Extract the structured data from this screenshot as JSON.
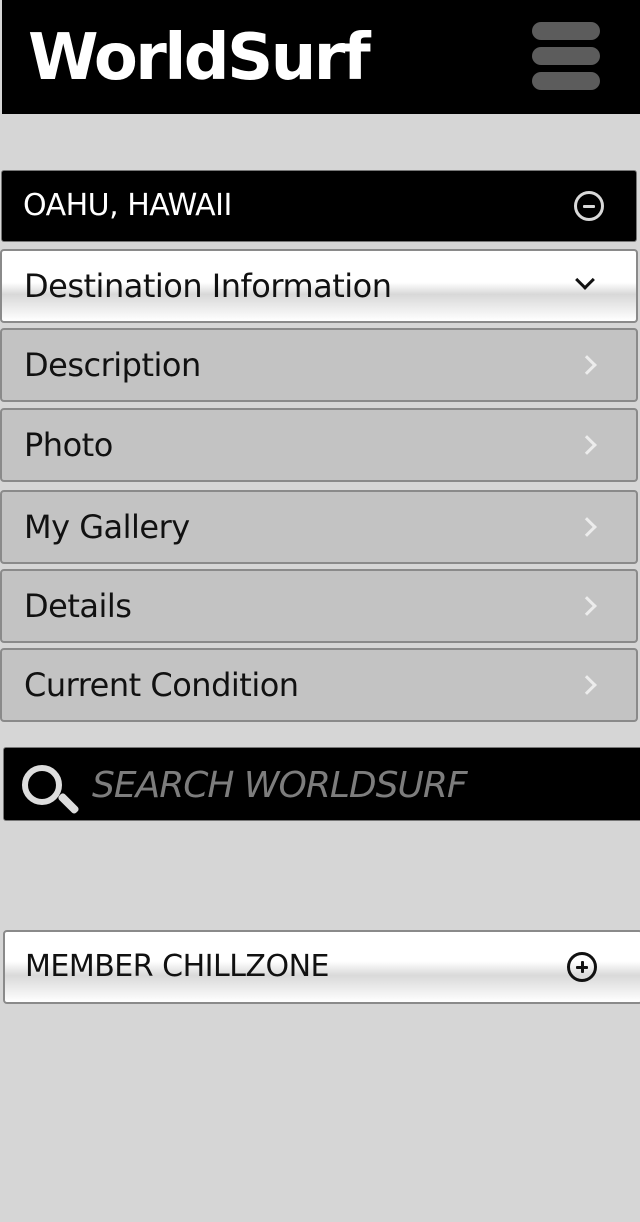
{
  "app": {
    "title": "WorldSurf"
  },
  "header": {
    "menu_icon": "hamburger-menu-icon"
  },
  "location_section": {
    "title": "OAHU, HAWAII",
    "toggle_icon": "minus-circle-icon",
    "items": [
      {
        "label": "Destination Information",
        "state": "expanded",
        "icon": "chevron-down-icon"
      },
      {
        "label": "Description",
        "state": "collapsed",
        "icon": "chevron-right-icon"
      },
      {
        "label": "Photo",
        "state": "collapsed",
        "icon": "chevron-right-icon"
      },
      {
        "label": "My Gallery",
        "state": "collapsed",
        "icon": "chevron-right-icon"
      },
      {
        "label": "Details",
        "state": "collapsed",
        "icon": "chevron-right-icon"
      },
      {
        "label": "Current Condition",
        "state": "collapsed",
        "icon": "chevron-right-icon"
      }
    ]
  },
  "search": {
    "placeholder": "SEARCH WORLDSURF",
    "value": "",
    "icon": "search-icon"
  },
  "member_section": {
    "title": "MEMBER CHILLZONE",
    "toggle_icon": "plus-circle-icon"
  },
  "colors": {
    "header_bg": "#000000",
    "page_bg": "#d6d6d6",
    "row_bg": "#c3c3c3",
    "accent_light": "#ffffff"
  }
}
